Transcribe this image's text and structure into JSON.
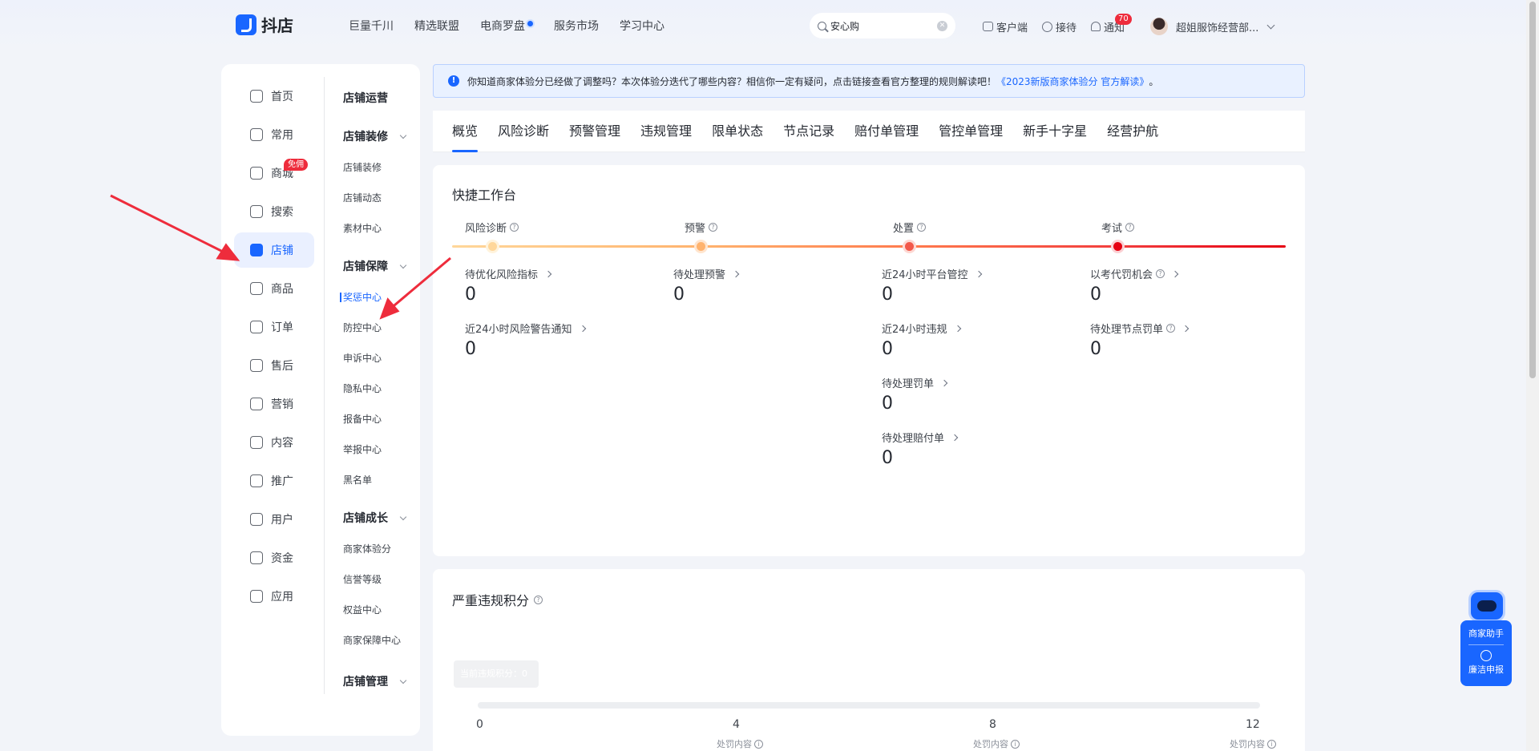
{
  "brand": {
    "name": "抖店"
  },
  "topmenu": [
    {
      "label": "巨量千川"
    },
    {
      "label": "精选联盟"
    },
    {
      "label": "电商罗盘",
      "dot": true
    },
    {
      "label": "服务市场"
    },
    {
      "label": "学习中心"
    }
  ],
  "search": {
    "value": "安心购"
  },
  "topright": {
    "customer": "客户端",
    "receive": "接待",
    "notice": "通知",
    "notice_count": "70",
    "user": "超姐服饰经营部..."
  },
  "leftnav": [
    {
      "label": "首页",
      "icon": "home-icon"
    },
    {
      "label": "常用",
      "icon": "folder-icon"
    },
    {
      "label": "商城",
      "icon": "mall-icon",
      "tag": "免佣"
    },
    {
      "label": "搜索",
      "icon": "search-stat-icon"
    },
    {
      "label": "店铺",
      "icon": "store-icon",
      "active": true
    },
    {
      "label": "商品",
      "icon": "bag-icon"
    },
    {
      "label": "订单",
      "icon": "order-icon"
    },
    {
      "label": "售后",
      "icon": "aftersale-icon"
    },
    {
      "label": "营销",
      "icon": "megaphone-icon"
    },
    {
      "label": "内容",
      "icon": "tv-icon"
    },
    {
      "label": "推广",
      "icon": "paperplane-icon"
    },
    {
      "label": "用户",
      "icon": "user-icon"
    },
    {
      "label": "资金",
      "icon": "wallet-icon"
    },
    {
      "label": "应用",
      "icon": "app-icon"
    }
  ],
  "subnav": {
    "store_ops": "店铺运营",
    "decor": {
      "title": "店铺装修",
      "items": [
        "店铺装修",
        "店铺动态",
        "素材中心"
      ]
    },
    "guarantee": {
      "title": "店铺保障",
      "items": [
        "奖惩中心",
        "防控中心",
        "申诉中心",
        "隐私中心",
        "报备中心",
        "举报中心",
        "黑名单"
      ]
    },
    "growth": {
      "title": "店铺成长",
      "items": [
        "商家体验分",
        "信誉等级",
        "权益中心",
        "商家保障中心"
      ]
    },
    "manage": {
      "title": "店铺管理"
    }
  },
  "notice": {
    "text": "你知道商家体验分已经做了调整吗？本次体验分迭代了哪些内容？相信你一定有疑问，点击链接查看官方整理的规则解读吧！",
    "link": "《2023新版商家体验分 官方解读》",
    "tail": "。"
  },
  "tabs": [
    "概览",
    "风险诊断",
    "预警管理",
    "违规管理",
    "限单状态",
    "节点记录",
    "赔付单管理",
    "管控单管理",
    "新手十字星",
    "经营护航"
  ],
  "workbench": {
    "title": "快捷工作台",
    "stages": [
      "风险诊断",
      "预警",
      "处置",
      "考试"
    ],
    "metrics": {
      "m1": {
        "label": "待优化风险指标",
        "value": "0"
      },
      "m2": {
        "label": "近24小时风险警告通知",
        "value": "0"
      },
      "m3": {
        "label": "待处理预警",
        "value": "0"
      },
      "m4": {
        "label": "近24小时平台管控",
        "value": "0"
      },
      "m5": {
        "label": "近24小时违规",
        "value": "0"
      },
      "m6": {
        "label": "待处理罚单",
        "value": "0"
      },
      "m7": {
        "label": "待处理赔付单",
        "value": "0"
      },
      "m8": {
        "label": "以考代罚机会",
        "value": "0"
      },
      "m9": {
        "label": "待处理节点罚单",
        "value": "0"
      }
    }
  },
  "violation": {
    "title": "严重违规积分",
    "tooltip": "当前违规积分：0",
    "ticks": [
      "0",
      "4",
      "8",
      "12"
    ],
    "tick_sub": "处罚内容"
  },
  "assistant": {
    "label1": "商家助手",
    "label2": "廉洁申报"
  },
  "colors": {
    "accent": "#1966ff",
    "danger": "#ee2c3c",
    "annotation": "#ee2c3c"
  }
}
